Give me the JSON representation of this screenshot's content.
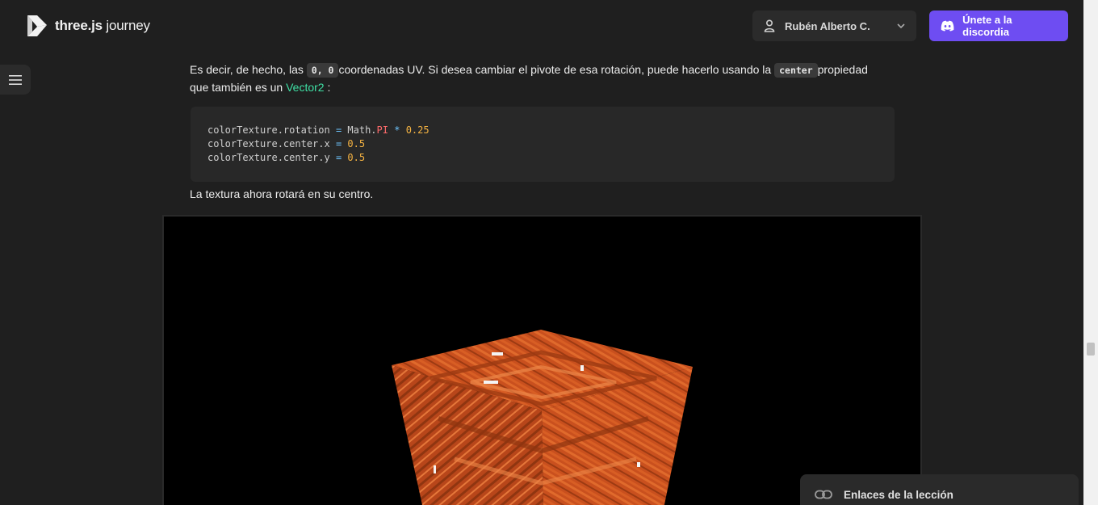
{
  "header": {
    "logo": {
      "bold": "three.js",
      "light": " journey"
    },
    "user": {
      "name": "Rubén Alberto C."
    },
    "discord_button": {
      "label": "Únete a la discordia"
    }
  },
  "content": {
    "p1": {
      "t1": "Es decir, de hecho, las ",
      "code1": "0, 0",
      "t2": "coordenadas UV. Si desea cambiar el pivote de esa rotación, puede hacerlo usando la ",
      "code2": "center",
      "t3": "propiedad que también es un ",
      "link": "Vector2",
      "t4": " :"
    },
    "code_block": {
      "line1": {
        "obj": "colorTexture.rotation ",
        "op": "=",
        "mid": " Math.",
        "prop": "PI",
        "op2": " * ",
        "num": "0.25"
      },
      "line2": {
        "obj": "colorTexture.center.x ",
        "op": "=",
        "sp": " ",
        "num": "0.5"
      },
      "line3": {
        "obj": "colorTexture.center.y ",
        "op": "=",
        "sp": " ",
        "num": "0.5"
      }
    },
    "p2": "La textura ahora rotará en su centro."
  },
  "lesson_links": {
    "label": "Enlaces de la lección"
  },
  "colors": {
    "background": "#1f1f1f",
    "accent": "#6e4df2",
    "link": "#3fe0a5",
    "cube": "#c9501e"
  },
  "icons": [
    "logo-icon",
    "user-icon",
    "chevron-down-icon",
    "discord-icon",
    "hamburger-icon",
    "link-icon"
  ]
}
